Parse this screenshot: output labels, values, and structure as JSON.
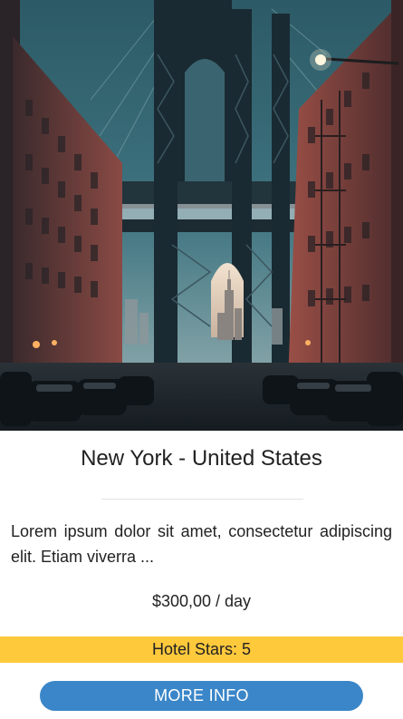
{
  "card": {
    "image_alt": "Manhattan Bridge framed by brick buildings in Brooklyn",
    "title": "New York - United States",
    "description": "Lorem ipsum dolor sit amet, consectetur adipiscing elit. Etiam viverra ...",
    "price": "$300,00 / day",
    "hotel_stars": "Hotel Stars: 5",
    "more_info_label": "MORE INFO"
  },
  "colors": {
    "accent_yellow": "#ffc93c",
    "button_blue": "#3a86c8"
  }
}
